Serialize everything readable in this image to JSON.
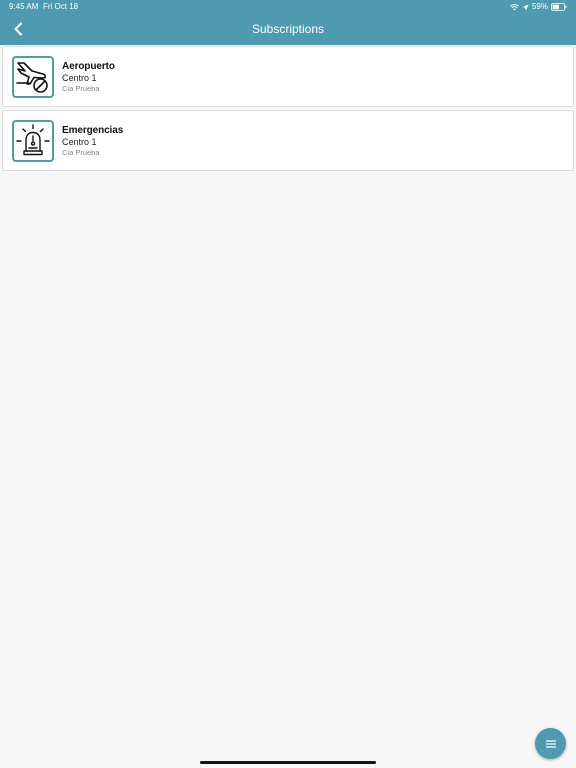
{
  "status_bar": {
    "time": "9:45 AM",
    "date": "Fri Oct 18",
    "battery": "59%",
    "battery_level": 0.59
  },
  "nav": {
    "title": "Subscriptions",
    "back_icon": "chevron-left-icon"
  },
  "subscriptions": [
    {
      "title": "Aeropuerto",
      "subtitle": "Centro 1",
      "org": "Cia Prueba",
      "icon": "no-flights-icon"
    },
    {
      "title": "Emergencias",
      "subtitle": "Centro 1",
      "org": "Cia Prueba",
      "icon": "siren-icon"
    }
  ],
  "fab": {
    "icon": "menu-icon"
  },
  "colors": {
    "accent": "#4e9ab0",
    "background": "#f7f7f7",
    "card": "#ffffff"
  }
}
